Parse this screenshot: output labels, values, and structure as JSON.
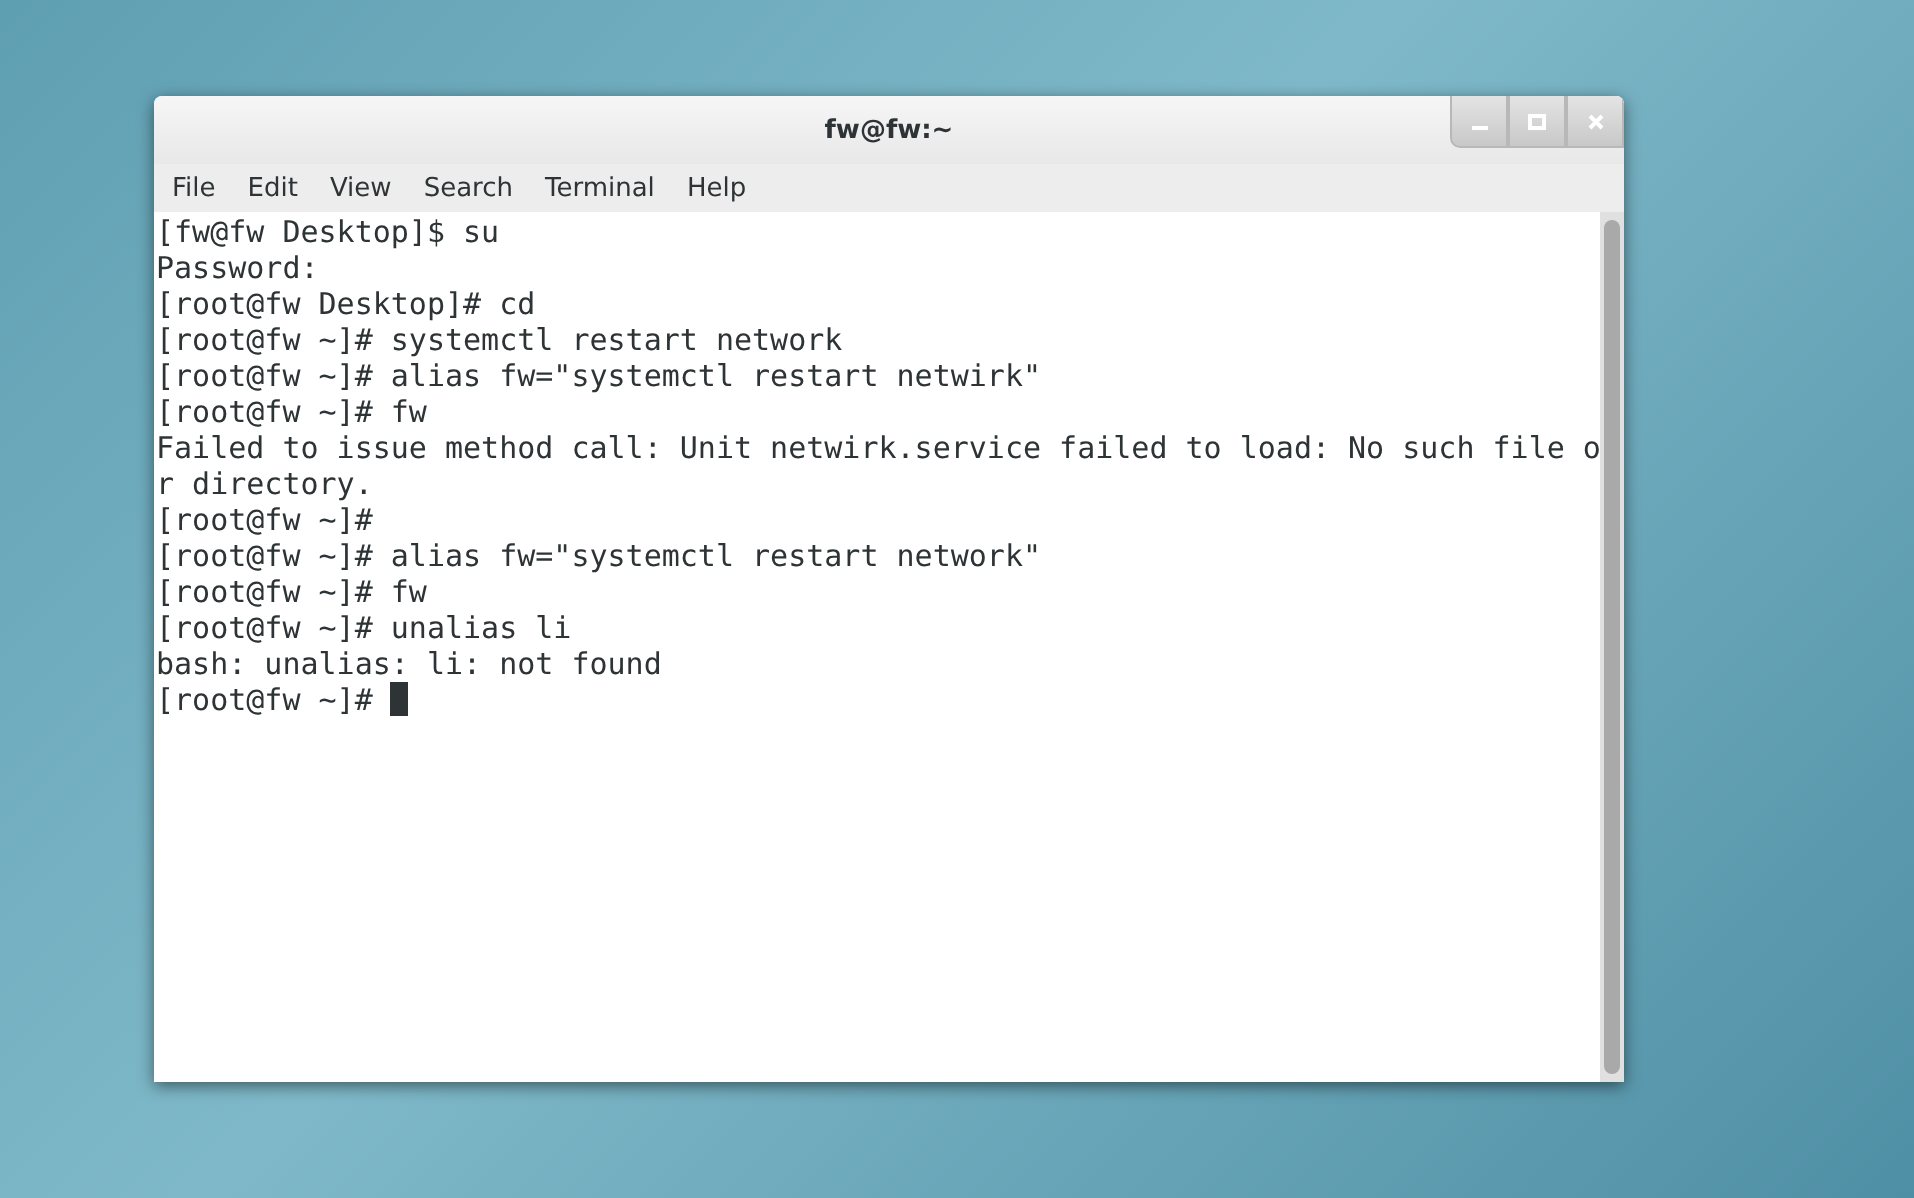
{
  "window": {
    "title": "fw@fw:~"
  },
  "menu": [
    "File",
    "Edit",
    "View",
    "Search",
    "Terminal",
    "Help"
  ],
  "terminal": {
    "lines": [
      "[fw@fw Desktop]$ su",
      "Password:",
      "[root@fw Desktop]# cd",
      "[root@fw ~]# systemctl restart network",
      "[root@fw ~]# alias fw=\"systemctl restart netwirk\"",
      "[root@fw ~]# fw",
      "Failed to issue method call: Unit netwirk.service failed to load: No such file o",
      "r directory.",
      "[root@fw ~]#",
      "[root@fw ~]# alias fw=\"systemctl restart network\"",
      "[root@fw ~]# fw",
      "[root@fw ~]# unalias li",
      "bash: unalias: li: not found",
      "[root@fw ~]# "
    ],
    "cursor_visible": true
  }
}
